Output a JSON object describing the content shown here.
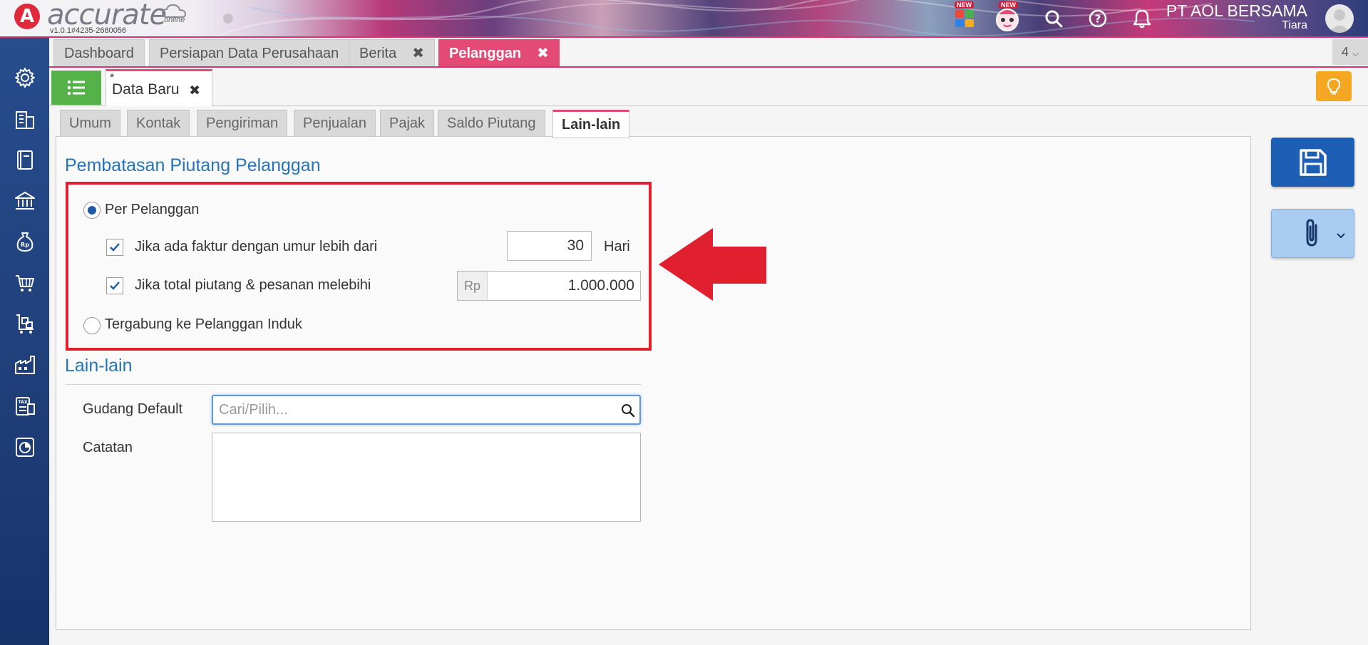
{
  "app": {
    "logo_letter": "A",
    "logo_text": "accurate",
    "logo_suffix": "online",
    "version": "v1.0.1#4235-2680056",
    "new_badge": "NEW",
    "company": "PT AOL BERSAMA",
    "user": "Tiara"
  },
  "tabs": [
    {
      "label": "Dashboard",
      "closable": false,
      "active": false
    },
    {
      "label": "Persiapan Data Perusahaan",
      "closable": false,
      "active": false
    },
    {
      "label": "Berita",
      "closable": true,
      "active": false
    },
    {
      "label": "Pelanggan",
      "closable": true,
      "active": true
    }
  ],
  "tab_close_glyph": "✖",
  "tab_count": "4",
  "document": {
    "title": "Data Baru",
    "dirty_mark": "*",
    "close_glyph": "✖"
  },
  "form_tabs": [
    "Umum",
    "Kontak",
    "Pengiriman",
    "Penjualan",
    "Pajak",
    "Saldo Piutang",
    "Lain-lain"
  ],
  "active_form_tab": "Lain-lain",
  "credit_limit": {
    "section_title": "Pembatasan Piutang Pelanggan",
    "option_per_customer": "Per Pelanggan",
    "option_per_customer_selected": true,
    "check_age_label": "Jika ada faktur dengan umur lebih dari",
    "check_age_checked": true,
    "age_value": "30",
    "age_unit": "Hari",
    "check_total_label": "Jika total piutang & pesanan melebihi",
    "check_total_checked": true,
    "currency_prefix": "Rp",
    "total_value": "1.000.000",
    "option_parent": "Tergabung ke Pelanggan Induk",
    "option_parent_selected": false
  },
  "other": {
    "section_title": "Lain-lain",
    "warehouse_label": "Gudang Default",
    "warehouse_placeholder": "Cari/Pilih...",
    "notes_label": "Catatan",
    "notes_value": ""
  },
  "colors": {
    "accent_pink": "#e34a75",
    "sidebar_blue": "#1f3e78",
    "highlight_red": "#e0202f",
    "section_blue": "#2673b8",
    "save_blue": "#1d5fb5"
  },
  "icons": {
    "sidebar": [
      "gear-icon",
      "building-icon",
      "book-icon",
      "bank-icon",
      "money-bag-icon",
      "cart-icon",
      "trolley-icon",
      "factory-icon",
      "tax-icon",
      "report-icon"
    ],
    "topbar": [
      "apps-icon",
      "mascot-icon",
      "search-icon",
      "help-icon",
      "bell-icon"
    ]
  }
}
